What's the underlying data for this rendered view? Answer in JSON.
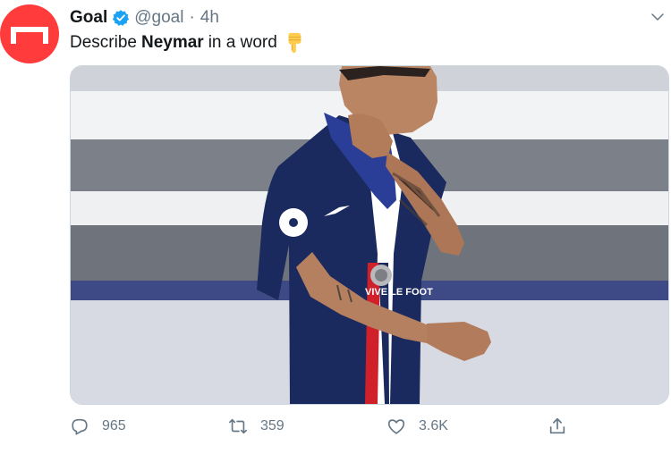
{
  "author": {
    "name": "Goal",
    "handle": "@goal",
    "separator": "·",
    "time": "4h"
  },
  "tweet": {
    "text_before": "Describe",
    "text_bold": "Neymar",
    "text_after": "in a word"
  },
  "media": {
    "jersey_text": "VIVE LE FOOT"
  },
  "actions": {
    "replies": "965",
    "retweets": "359",
    "likes": "3.6K"
  },
  "colors": {
    "avatar_bg": "#ff3b3b",
    "verified": "#1da1f2",
    "muted": "#657786"
  },
  "icons": [
    "goal-logo-icon",
    "verified-badge-icon",
    "chevron-down-icon",
    "pointing-down-emoji-icon",
    "reply-icon",
    "retweet-icon",
    "like-icon",
    "share-icon"
  ]
}
